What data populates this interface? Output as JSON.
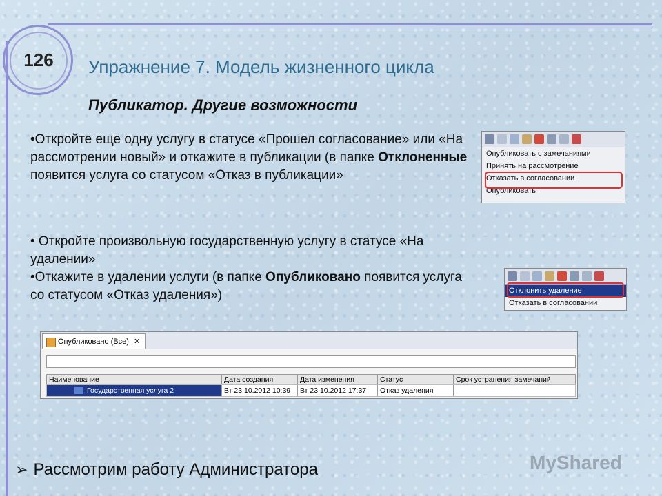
{
  "slide_number": "126",
  "title": "Упражнение 7. Модель жизненного цикла",
  "subtitle": "Публикатор. Другие возможности",
  "paragraph1": {
    "before": "•Откройте еще одну услугу в статусе «Прошел согласование» или «На рассмотрении новый» и откажите в публикации (в папке ",
    "bold": "Отклоненные",
    "after": " появится услуга со статусом «Отказ в публикации»"
  },
  "paragraph2": {
    "line1": "• Откройте произвольную государственную услугу в статусе «На удалении»",
    "line2_before": "•Откажите в удалении услуги (в папке ",
    "line2_bold": "Опубликовано",
    "line2_after": " появится услуга со статусом «Отказ удаления»)"
  },
  "menu1": {
    "items": [
      "Опубликовать с замечаниями",
      "Принять на рассмотрение",
      "Отказать в согласовании",
      "Опубликовать"
    ]
  },
  "menu2": {
    "items": [
      "Отклонить удаление",
      "Отказать в согласовании"
    ]
  },
  "grid": {
    "tab_label": "Опубликовано (Все)",
    "tab_close": "✕",
    "columns": [
      "Наименование",
      "Дата создания",
      "Дата изменения",
      "Статус",
      "Срок устранения замечаний"
    ],
    "row": [
      "Государственная услуга 2",
      "Вт 23.10.2012 10:39",
      "Вт 23.10.2012 17:37",
      "Отказ удаления",
      ""
    ]
  },
  "footer": "Рассмотрим работу Администратора",
  "watermark": "MyShared",
  "colors": {
    "title": "#2f6a8f",
    "frame": "#8f8fd4",
    "highlight": "#dd3333",
    "selection": "#1f3a8a"
  }
}
